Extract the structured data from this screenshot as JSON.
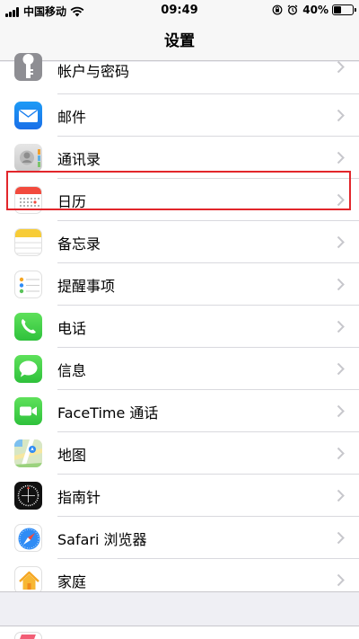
{
  "status_bar": {
    "carrier": "中国移动",
    "time": "09:49",
    "battery": "40%",
    "battery_level": 0.4
  },
  "nav": {
    "title": "设置"
  },
  "rows": [
    {
      "id": "accounts",
      "label": "帐户与密码",
      "icon": "key-icon"
    },
    {
      "id": "mail",
      "label": "邮件",
      "icon": "mail-icon"
    },
    {
      "id": "contacts",
      "label": "通讯录",
      "icon": "contacts-icon"
    },
    {
      "id": "calendar",
      "label": "日历",
      "icon": "calendar-icon"
    },
    {
      "id": "notes",
      "label": "备忘录",
      "icon": "notes-icon"
    },
    {
      "id": "reminders",
      "label": "提醒事项",
      "icon": "reminders-icon"
    },
    {
      "id": "phone",
      "label": "电话",
      "icon": "phone-icon"
    },
    {
      "id": "messages",
      "label": "信息",
      "icon": "messages-icon"
    },
    {
      "id": "facetime",
      "label": "FaceTime 通话",
      "icon": "facetime-icon"
    },
    {
      "id": "maps",
      "label": "地图",
      "icon": "maps-icon"
    },
    {
      "id": "compass",
      "label": "指南针",
      "icon": "compass-icon"
    },
    {
      "id": "safari",
      "label": "Safari 浏览器",
      "icon": "safari-icon"
    },
    {
      "id": "home",
      "label": "家庭",
      "icon": "home-icon"
    }
  ],
  "colors": {
    "highlight": "#e2262b",
    "chevron": "#c7c7cc"
  }
}
